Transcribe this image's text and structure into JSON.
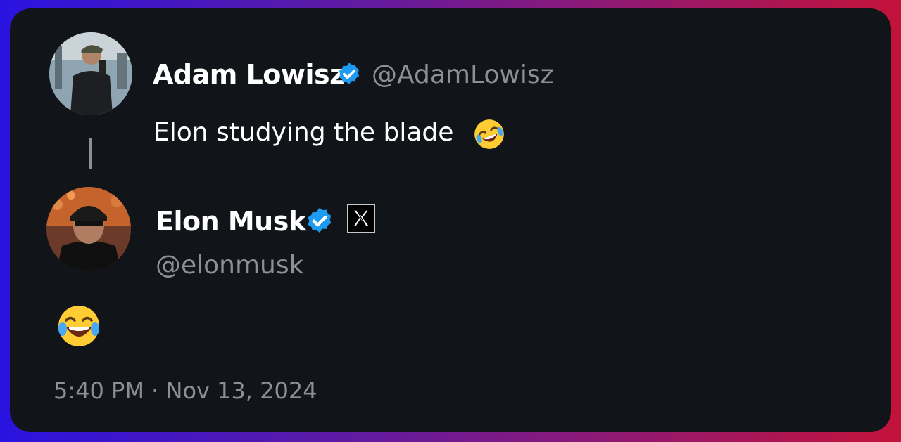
{
  "tweets": [
    {
      "display_name": "Adam Lowisz",
      "handle": "@AdamLowisz",
      "verified": true,
      "text": "Elon studying the blade",
      "emoji_icon": "rofl-emoji"
    },
    {
      "display_name": "Elon Musk",
      "handle": "@elonmusk",
      "verified": true,
      "affiliate_icon": "x-logo-icon",
      "text_emoji_icon": "tears-of-joy-emoji"
    }
  ],
  "timestamp": "5:40 PM · Nov 13, 2024",
  "colors": {
    "card": "#111418",
    "verified_badge": "#1d9bf0",
    "muted_text": "#8b9096"
  }
}
